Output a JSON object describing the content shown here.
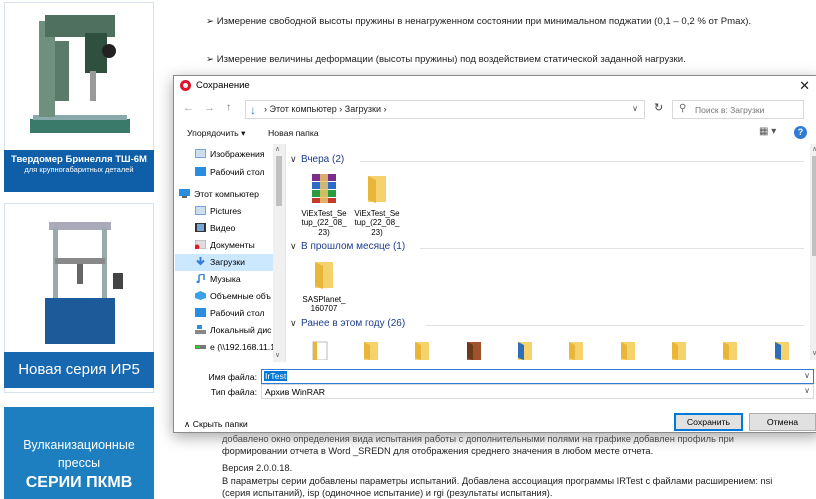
{
  "page": {
    "ads": [
      {
        "line1": "Твердомер Бринелля ТШ-6М",
        "line2": "для крупногабаритных деталей"
      },
      {
        "line1": "Новая серия ИР5"
      },
      {
        "line1": "Вулканизационные",
        "line2": "прессы",
        "line3": "СЕРИИ ПКМВ"
      }
    ],
    "bullet1": "➢ Измерение свободной высоты пружины в ненагруженном состоянии при минимальном поджатии (0,1 – 0,2 % от Pmax).",
    "bullet2": "➢ Измерение величины деформации (высоты пружины) под воздействием статической заданной нагрузки.",
    "para_partial": "добавлено окно определения вида испытания работы с дополнительными полями на графике добавлен профиль при",
    "para_line2": "формировании отчета в Word _SREDN для отображения среднего значения в любом месте отчета.",
    "version": "Версия 2.0.0.18.",
    "para2_line1": "В параметры серии добавлены параметры испытаний. Добавлена ассоциация программы IRTest с файлами расширением: nsi",
    "para2_line2": "(серия испытаний), isp (одиночное испытание) и rgi (результаты испытания)."
  },
  "dialog": {
    "title": "Сохранение",
    "close": "✕",
    "breadcrumb": "›  Этот компьютер  ›  Загрузки  ›",
    "search_placeholder": "Поиск в: Загрузки",
    "toolbar": {
      "organize": "Упорядочить ▾",
      "new_folder": "Новая папка"
    },
    "nav": [
      {
        "label": "Изображения",
        "icon": "pictures-folder-icon"
      },
      {
        "label": "Рабочий стол",
        "icon": "desktop-folder-icon"
      },
      {
        "label": "Этот компьютер",
        "icon": "computer-icon"
      },
      {
        "label": "Pictures",
        "icon": "pictures-folder-icon"
      },
      {
        "label": "Видео",
        "icon": "video-folder-icon"
      },
      {
        "label": "Документы",
        "icon": "documents-folder-icon"
      },
      {
        "label": "Загрузки",
        "icon": "downloads-icon",
        "selected": true
      },
      {
        "label": "Музыка",
        "icon": "music-icon"
      },
      {
        "label": "Объемные объ",
        "icon": "3d-objects-icon"
      },
      {
        "label": "Рабочий стол",
        "icon": "desktop-folder-icon"
      },
      {
        "label": "Локальный дис",
        "icon": "drive-icon"
      },
      {
        "label": "e (\\\\192.168.11.1",
        "icon": "network-drive-icon"
      }
    ],
    "groups": [
      {
        "label": "Вчера (2)"
      },
      {
        "label": "В прошлом месяце (1)"
      },
      {
        "label": "Ранее в этом году (26)"
      }
    ],
    "files": [
      {
        "name": "ViExTest_Setup_(22_08_23)",
        "name_lines": [
          "ViExTest_Se",
          "tup_(22_08_",
          "23)"
        ],
        "icon": "winrar-archive-icon"
      },
      {
        "name": "ViExTest_Setup_(22_08_23)",
        "name_lines": [
          "ViExTest_Se",
          "tup_(22_08_",
          "23)"
        ],
        "icon": "folder-icon"
      },
      {
        "name": "SASPlanet_160707",
        "name_lines": [
          "SASPlanet_",
          "160707"
        ],
        "icon": "folder-icon"
      }
    ],
    "filename_label": "Имя файла:",
    "filename_value": "IrTest",
    "filetype_label": "Тип файла:",
    "filetype_value": "Архив WinRAR",
    "hide_folders": "∧  Скрыть папки",
    "save_button": "Сохранить",
    "cancel_button": "Отмена"
  }
}
